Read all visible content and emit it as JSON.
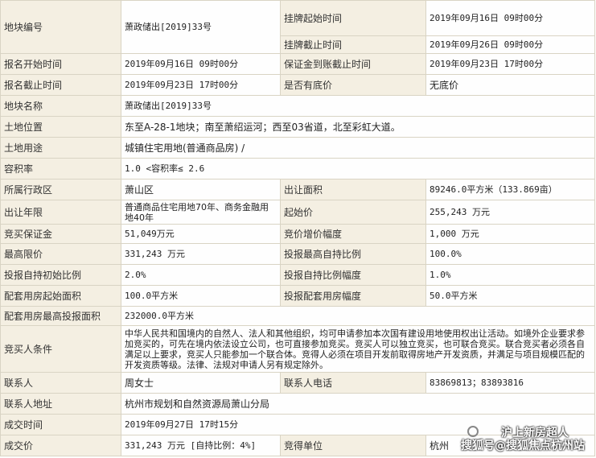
{
  "rows": [
    {
      "type": "4",
      "h": 22,
      "l1": "地块编号",
      "v1": "萧政储出[2019]33号",
      "l2": "挂牌起始时间",
      "v2": "2019年09月16日 09时00分"
    },
    {
      "type": "2",
      "h": 22,
      "l2": "挂牌截止时间",
      "v2": "2019年09月26日 09时00分"
    },
    {
      "type": "4",
      "h": 26,
      "l1": "报名开始时间",
      "v1": "2019年09月16日 09时00分",
      "l2": "保证金到账截止时间",
      "v2": "2019年09月23日 17时00分"
    },
    {
      "type": "4",
      "h": 26,
      "l1": "报名截止时间",
      "v1": "2019年09月23日 17时00分",
      "l2": "是否有底价",
      "v2": "无底价"
    },
    {
      "type": "2",
      "h": 26,
      "l1": "地块名称",
      "v1": "萧政储出[2019]33号"
    },
    {
      "type": "2",
      "h": 26,
      "l1": "土地位置",
      "v1": "东至A-28-1地块；南至萧绍运河；西至03省道，北至彩虹大道。"
    },
    {
      "type": "2",
      "h": 26,
      "l1": "土地用途",
      "v1": "城镇住宅用地(普通商品房) /"
    },
    {
      "type": "2",
      "h": 26,
      "l1": "容积率",
      "v1": "1.0 <容积率≤ 2.6"
    },
    {
      "type": "4",
      "h": 26,
      "l1": "所属行政区",
      "v1": "萧山区",
      "l2": "出让面积",
      "v2": "89246.0平方米（133.869亩）"
    },
    {
      "type": "4",
      "h": 26,
      "l1": "出让年限",
      "v1": "普通商品住宅用地70年、商务金融用地40年",
      "l2": "起始价",
      "v2": "255,243 万元"
    },
    {
      "type": "4",
      "h": 26,
      "l1": "竞买保证金",
      "v1": "51,049万元",
      "l2": "竞价增价幅度",
      "v2": "1,000 万元"
    },
    {
      "type": "4",
      "h": 26,
      "l1": "最高限价",
      "v1": "331,243 万元",
      "l2": "投报最高自持比例",
      "v2": "100.0%"
    },
    {
      "type": "4",
      "h": 26,
      "l1": "投报自持初始比例",
      "v1": "2.0%",
      "l2": "投报自持比例幅度",
      "v2": "1.0%"
    },
    {
      "type": "4",
      "h": 26,
      "l1": "配套用房起始面积",
      "v1": "100.0平方米",
      "l2": "投报配套用房幅度",
      "v2": "50.0平方米"
    },
    {
      "type": "2",
      "h": 26,
      "l1": "配套用房最高投报面积",
      "v1": "232000.0平方米"
    },
    {
      "type": "2",
      "h": 58,
      "l1": "竞买人条件",
      "v1": "中华人民共和国境内的自然人、法人和其他组织，均可申请参加本次国有建设用地使用权出让活动。如境外企业要求参加竞买的，可先在境内依法设立公司，也可直接参加竞买。竞买人可以独立竞买，也可联合竞买。联合竞买者必须各自满足以上要求，竞买人只能参加一个联合体。竞得人必须在项目开发前取得房地产开发资质，并满足与项目规模匹配的开发资质等级。法律、法规对申请人另有规定除外。"
    },
    {
      "type": "4",
      "h": 26,
      "l1": "联系人",
      "v1": "周女士",
      "l2": "联系人电话",
      "v2": "83869813；83893816"
    },
    {
      "type": "2",
      "h": 26,
      "l1": "联系人地址",
      "v1": "杭州市规划和自然资源局萧山分局"
    },
    {
      "type": "2",
      "h": 26,
      "l1": "成交时间",
      "v1": "2019年09月27日 17时15分"
    },
    {
      "type": "4",
      "h": 26,
      "l1": "成交价",
      "v1": "331,243 万元 [自持比例：4%]",
      "l2": "竞得单位",
      "v2": "杭州"
    }
  ],
  "watermark": {
    "line1": "沪上新房超人",
    "line2": "搜狐号@搜狐焦点杭州站"
  }
}
